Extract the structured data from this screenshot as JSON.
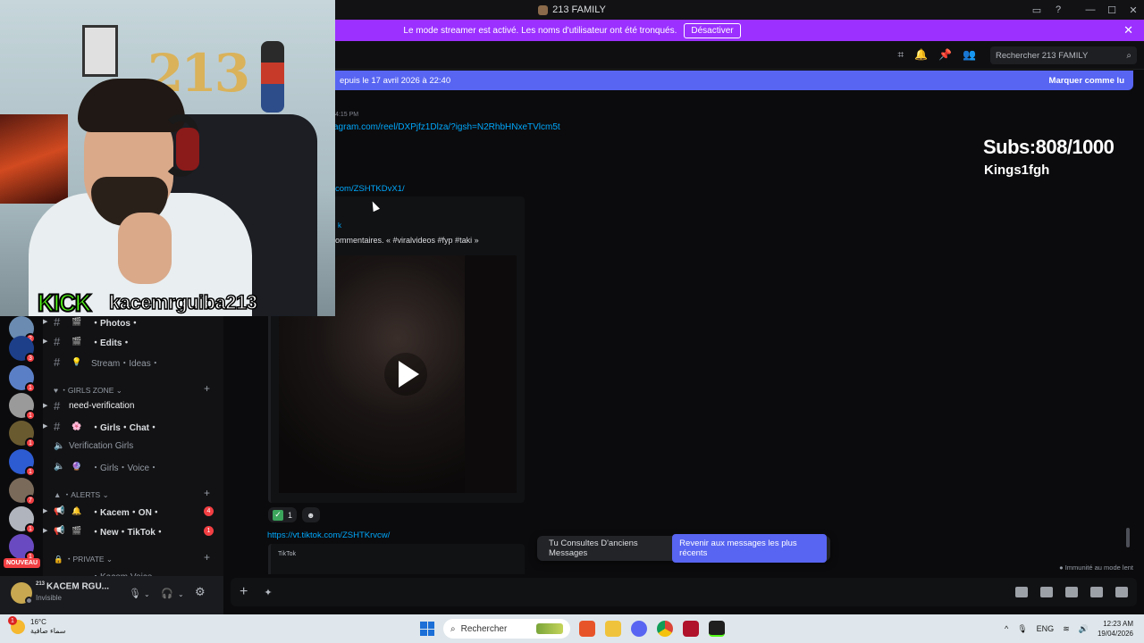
{
  "window": {
    "title": "213 FAMILY"
  },
  "streamer_banner": {
    "text": "Le mode streamer est activé. Les noms d'utilisateur ont été tronqués.",
    "button": "Désactiver"
  },
  "header": {
    "search_placeholder": "Rechercher 213 FAMILY"
  },
  "new_messages": {
    "text": "epuis le 17 avril 2026 à 22:40",
    "mark_read": "Marquer comme lu"
  },
  "messages": {
    "time": "4:15 PM",
    "link1": "agram.com/reel/DXPjfz1Dlza/?igsh=N2RhbHNxeTVlcm5t",
    "link2": "com/ZSHTKDvX1/",
    "embed_author": "k",
    "embed_desc": "ommentaires. « #viralvideos #fyp #taki »",
    "reaction_count": "1",
    "link3": "https://vt.tiktok.com/ZSHTKrvcw/",
    "embed2_provider": "TikTok"
  },
  "jump_bar": {
    "text": "Tu Consultes D'anciens Messages",
    "button": "Revenir aux messages les plus récents"
  },
  "slow_mode": "Immunité au mode lent",
  "overlay": {
    "subs": "Subs:808/1000",
    "name": "Kings1fgh",
    "kick": "KICK",
    "kick_user": "kacemrguiba213"
  },
  "guilds": {
    "badges": [
      "2",
      "3",
      "1",
      "1",
      "1",
      "1",
      "7",
      "1",
      "1"
    ],
    "new_label": "NOUVEAU"
  },
  "channels": {
    "items": [
      {
        "label": "・Photos・",
        "icon": "🎬"
      },
      {
        "label": "・Edits・",
        "icon": "🎬"
      },
      {
        "label": "Stream・Ideas・",
        "icon": "💡"
      }
    ],
    "cat_girls": "GIRLS ZONE",
    "girls": [
      {
        "label": "need-verification"
      },
      {
        "label": "・Girls・Chat・",
        "icon": "🌸"
      },
      {
        "label": "Verification Girls"
      },
      {
        "label": "・Girls・Voice・",
        "icon": "🔮"
      }
    ],
    "cat_alerts": "ALERTS",
    "alerts": [
      {
        "label": "・Kacem・ON・",
        "icon": "🔔",
        "count": "4"
      },
      {
        "label": "・New・TikTok・",
        "icon": "🎬",
        "count": "1"
      }
    ],
    "cat_private": "Private",
    "private_partial": "・Kacem Voice"
  },
  "user": {
    "tag": "213",
    "name": "KACEM RGU...",
    "status": "Invisible"
  },
  "taskbar": {
    "weather_badge": "1",
    "temp": "16°C",
    "weather_desc": "سماء صافية",
    "search": "Rechercher",
    "lang": "ENG",
    "time": "12:23 AM",
    "date": "19/04/2026"
  }
}
